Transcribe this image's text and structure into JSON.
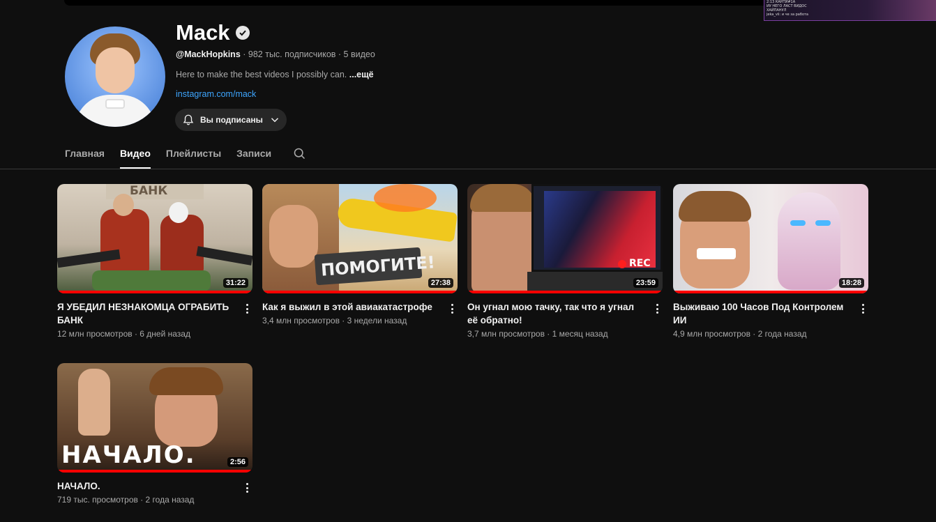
{
  "channel": {
    "name": "Mack",
    "handle": "@MackHopkins",
    "stats": " · 982 тыс. подписчиков · 5 видео",
    "description": "Here to make the best videos I possibly can. ",
    "more_label": "...ещё",
    "link": "instagram.com/mack",
    "subscribe_label": "Вы подписаны"
  },
  "overlay": {
    "lines": [
      "2:13 КАНТИ#1А",
      "ИУ НЕГО ЛАСТ ВИДОС",
      "ХАЙПАНУЛ",
      "jeka_vii: и че за работа"
    ]
  },
  "tabs": [
    {
      "label": "Главная",
      "active": false
    },
    {
      "label": "Видео",
      "active": true
    },
    {
      "label": "Плейлисты",
      "active": false
    },
    {
      "label": "Записи",
      "active": false
    }
  ],
  "videos": [
    {
      "title": "Я УБЕДИЛ НЕЗНАКОМЦА ОГРАБИТЬ БАНК",
      "meta": "12 млн просмотров · 6 дней назад",
      "duration": "31:22",
      "thumb_text": "БАНК"
    },
    {
      "title": "Как я выжил в этой авиакатастрофе",
      "meta": "3,4 млн просмотров · 3 недели назад",
      "duration": "27:38",
      "thumb_text": "ПОМОГИТЕ!"
    },
    {
      "title": "Он угнал мою тачку, так что я угнал её обратно!",
      "meta": "3,7 млн просмотров · 1 месяц назад",
      "duration": "23:59",
      "thumb_text": "REC"
    },
    {
      "title": "Выживаю 100 Часов Под Контролем ИИ",
      "meta": "4,9 млн просмотров · 2 года назад",
      "duration": "18:28",
      "thumb_text": ""
    },
    {
      "title": "НАЧАЛО.",
      "meta": "719 тыс. просмотров · 2 года назад",
      "duration": "2:56",
      "thumb_text": "НАЧАЛО."
    }
  ],
  "colors": {
    "background": "#0f0f0f",
    "link": "#3ea6ff",
    "progress": "#ff0000",
    "button_bg": "#272727"
  }
}
